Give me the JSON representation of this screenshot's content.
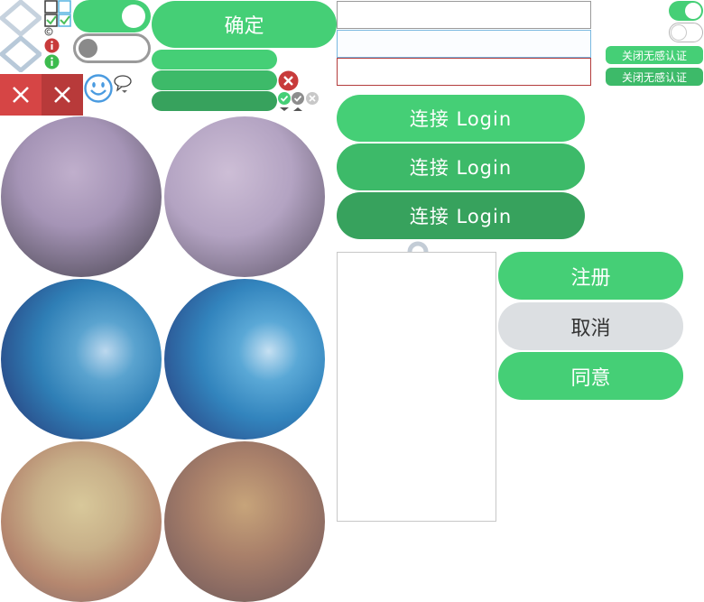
{
  "colors": {
    "green": "#45cf76",
    "green_dark": "#3dba69",
    "green_darker": "#37a25d",
    "red": "#d64545",
    "red_dark": "#b83a3a",
    "grey_button": "#dcdfe2",
    "text_dark": "#333333"
  },
  "top_left": {
    "confirm_label": "确定"
  },
  "icons": [
    "diamond-outline-icon",
    "checkbox-icon",
    "copyright-icon",
    "info-red-icon",
    "info-green-icon",
    "close-icon",
    "smiley-icon",
    "chat-bubble-icon",
    "error-icon",
    "check-icon",
    "spinner-ring-icon"
  ],
  "toggles": {
    "large_on": true,
    "large_off": false,
    "small_on": true,
    "small_off": false
  },
  "right_top": {
    "badge_1": "关闭无感认证",
    "badge_2": "关闭无感认证"
  },
  "login_buttons": [
    {
      "label": "连接 Login"
    },
    {
      "label": "连接 Login"
    },
    {
      "label": "连接 Login"
    }
  ],
  "dialog_buttons": {
    "register": "注册",
    "cancel": "取消",
    "agree": "同意"
  }
}
